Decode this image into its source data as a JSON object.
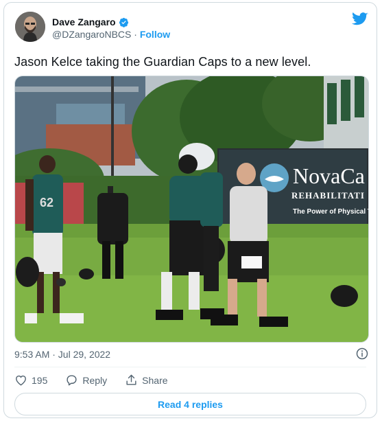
{
  "author": {
    "name": "Dave Zangaro",
    "handle": "@DZangaroNBCS",
    "separator": "·",
    "follow_label": "Follow"
  },
  "icons": {
    "verified": "verified-badge-icon",
    "brand": "twitter-bird-icon",
    "info": "info-icon",
    "like": "heart-icon",
    "reply": "reply-icon",
    "share": "share-icon"
  },
  "tweet": {
    "text": "Jason Kelce taking the Guardian Caps to a new level.",
    "timestamp": "9:53 AM · Jul 29, 2022"
  },
  "photo": {
    "banner_brand": "NovaCa",
    "banner_sub": "REHABILITATI",
    "banner_tag": "The Power of Physical Th",
    "jersey_number": "62"
  },
  "engagement": {
    "like_count": "195",
    "reply_label": "Reply",
    "share_label": "Share"
  },
  "replies_button": "Read 4 replies",
  "colors": {
    "accent": "#1d9bf0",
    "text": "#0f1419",
    "muted": "#536471",
    "border": "#cfd9de"
  }
}
